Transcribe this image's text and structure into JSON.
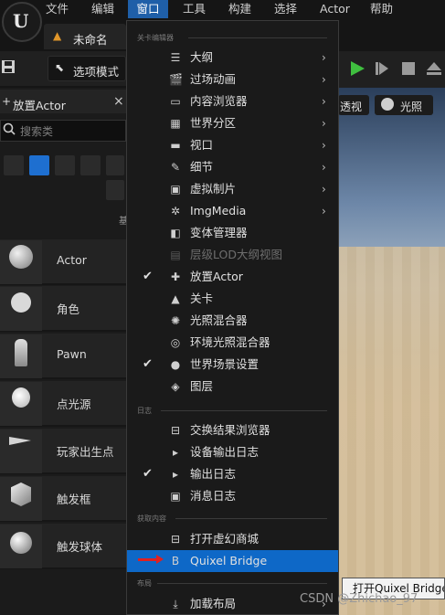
{
  "menubar": {
    "items": [
      "文件",
      "编辑",
      "窗口",
      "工具",
      "构建",
      "选择",
      "Actor",
      "帮助"
    ]
  },
  "doc_tab": {
    "label": "未命名"
  },
  "toolbar": {
    "mode_label": "选项模式"
  },
  "viewport": {
    "perspective_label": "透视",
    "lighting_label": "光照"
  },
  "place_actor": {
    "tab_label": "放置Actor",
    "close": "×",
    "search_placeholder": "搜索类",
    "basic_label": "基",
    "items": [
      "Actor",
      "角色",
      "Pawn",
      "点光源",
      "玩家出生点",
      "触发框",
      "触发球体"
    ]
  },
  "dropdown": {
    "section_level_editor": "关卡编辑器",
    "section_log": "日志",
    "section_get_content": "获取内容",
    "section_layout": "布局",
    "level_editor_items": [
      {
        "label": "大纲",
        "icon": "outliner-icon",
        "arrow": "›"
      },
      {
        "label": "过场动画",
        "icon": "cinematics-icon",
        "arrow": "›"
      },
      {
        "label": "内容浏览器",
        "icon": "content-browser-icon",
        "arrow": "›"
      },
      {
        "label": "世界分区",
        "icon": "world-partition-icon",
        "arrow": "›"
      },
      {
        "label": "视口",
        "icon": "viewport-icon",
        "arrow": "›"
      },
      {
        "label": "细节",
        "icon": "details-icon",
        "arrow": "›"
      },
      {
        "label": "虚拟制片",
        "icon": "virtual-production-icon",
        "arrow": "›"
      },
      {
        "label": "ImgMedia",
        "icon": "imgmedia-icon",
        "arrow": "›"
      },
      {
        "label": "变体管理器",
        "icon": "variant-manager-icon",
        "arrow": ""
      },
      {
        "label": "层级LOD大纲视图",
        "icon": "hlod-icon",
        "arrow": "",
        "disabled": true
      },
      {
        "label": "放置Actor",
        "icon": "place-actor-icon",
        "arrow": "",
        "checked": true
      },
      {
        "label": "关卡",
        "icon": "levels-icon",
        "arrow": ""
      },
      {
        "label": "光照混合器",
        "icon": "light-mixer-icon",
        "arrow": ""
      },
      {
        "label": "环境光照混合器",
        "icon": "env-light-mixer-icon",
        "arrow": ""
      },
      {
        "label": "世界场景设置",
        "icon": "world-settings-icon",
        "arrow": "",
        "checked": true
      },
      {
        "label": "图层",
        "icon": "layers-icon",
        "arrow": ""
      }
    ],
    "log_items": [
      {
        "label": "交换结果浏览器",
        "icon": "interchange-icon"
      },
      {
        "label": "设备输出日志",
        "icon": "device-log-icon"
      },
      {
        "label": "输出日志",
        "icon": "output-log-icon",
        "checked": true
      },
      {
        "label": "消息日志",
        "icon": "message-log-icon"
      }
    ],
    "content_items": [
      {
        "label": "打开虚幻商城",
        "icon": "marketplace-icon"
      },
      {
        "label": "Quixel Bridge",
        "icon": "quixel-bridge-icon",
        "highlighted": true
      }
    ],
    "layout_items": [
      {
        "label": "加载布局",
        "icon": "load-layout-icon",
        "arrow": "›"
      }
    ],
    "check_mark": "✔"
  },
  "tooltip": {
    "text": "打开Quixel Bridge。"
  },
  "watermark": {
    "text": "CSDN @Zhichao_97"
  },
  "colors": {
    "highlight": "#0e68c7",
    "menu_active": "#1f5fa8",
    "play": "#3fbf3f"
  }
}
